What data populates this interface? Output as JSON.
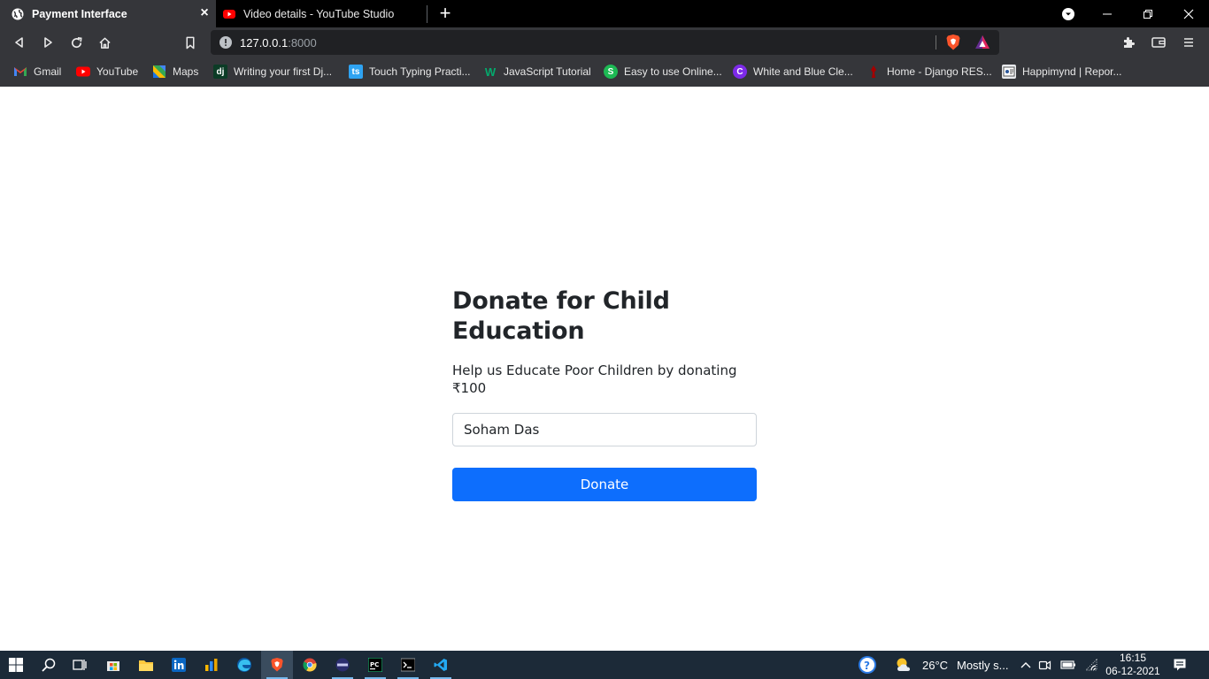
{
  "browser": {
    "tabs": [
      {
        "title": "Payment Interface",
        "active": true,
        "icon": "globe-icon"
      },
      {
        "title": "Video details - YouTube Studio",
        "active": false,
        "icon": "youtube-icon"
      }
    ],
    "url_host": "127.0.0.1",
    "url_port": ":8000",
    "bookmarks": [
      {
        "label": "Gmail",
        "icon": "gmail-icon"
      },
      {
        "label": "YouTube",
        "icon": "youtube-icon"
      },
      {
        "label": "Maps",
        "icon": "maps-icon"
      },
      {
        "label": "Writing your first Dj...",
        "icon": "django-icon",
        "icon_text": "dj"
      },
      {
        "label": "Touch Typing Practi...",
        "icon": "typing-icon",
        "icon_text": "ts"
      },
      {
        "label": "JavaScript Tutorial",
        "icon": "w3schools-icon",
        "icon_text": "W"
      },
      {
        "label": "Easy to use Online...",
        "icon": "s-icon",
        "icon_text": "S"
      },
      {
        "label": "White and Blue Cle...",
        "icon": "canva-icon",
        "icon_text": "C"
      },
      {
        "label": "Home - Django RES...",
        "icon": "drf-icon"
      },
      {
        "label": "Happimynd | Repor...",
        "icon": "happimynd-icon"
      }
    ]
  },
  "page": {
    "title": "Donate for Child Education",
    "subtitle": "Help us Educate Poor Children by donating ₹100",
    "name_value": "Soham Das",
    "donate_label": "Donate"
  },
  "taskbar": {
    "weather_temp": "26°C",
    "weather_desc": "Mostly s...",
    "time": "16:15",
    "date": "06-12-2021"
  },
  "colors": {
    "primary_button": "#0d6efd",
    "browser_chrome": "#35363a",
    "taskbar": "#1c2a38"
  }
}
